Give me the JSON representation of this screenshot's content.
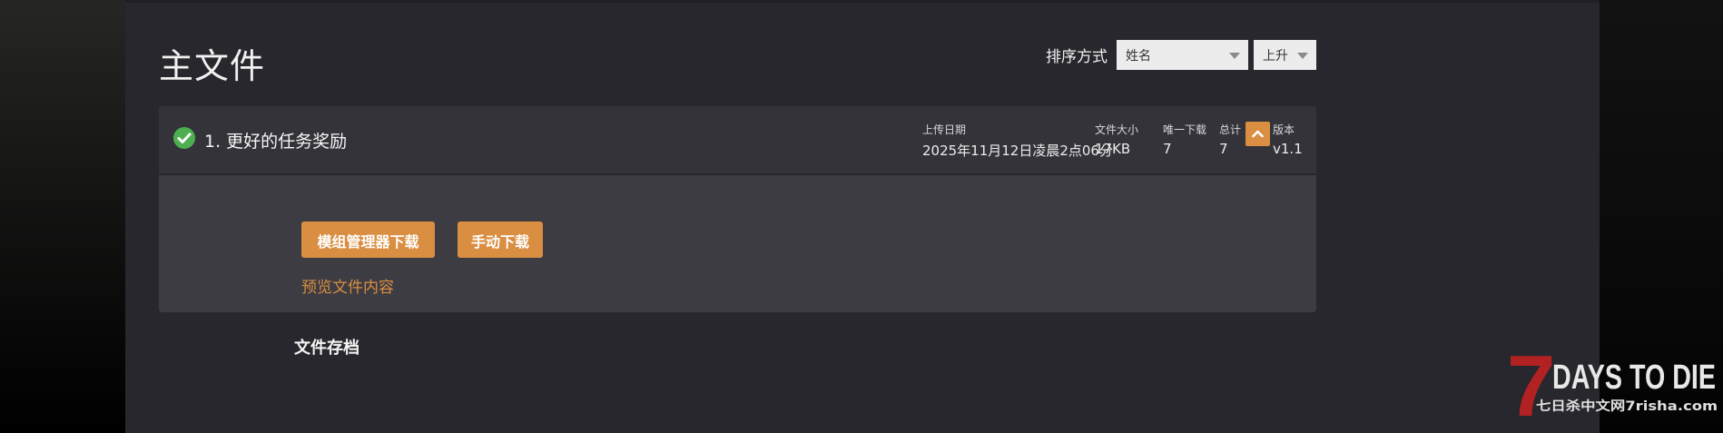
{
  "page": {
    "title": "主文件",
    "archive_title": "文件存档"
  },
  "sort": {
    "label": "排序方式",
    "field_value": "姓名",
    "order_value": "上升"
  },
  "file": {
    "name": "1. 更好的任务奖励",
    "status_icon": "check-circle-icon",
    "meta": {
      "upload_date_label": "上传日期",
      "upload_date_value": "2025年11月12日凌晨2点06分",
      "size_label": "文件大小",
      "size_value": "17KB",
      "unique_dl_label": "唯一下载",
      "unique_dl_value": "7",
      "total_dl_label": "总计 DL",
      "total_dl_value": "7",
      "version_label": "版本",
      "version_value": "v1.1"
    },
    "buttons": {
      "mod_manager_download": "模组管理器下载",
      "manual_download": "手动下载"
    },
    "preview_link": "预览文件内容"
  },
  "logo": {
    "title": "DAYS TO DIE",
    "numeral": "7",
    "subtitle": "七日杀中文网7risha.com"
  },
  "colors": {
    "accent": "#d98e42",
    "panel_bg": "#28272d",
    "card_bg": "#3d3c42",
    "check_green": "#4caf50"
  }
}
